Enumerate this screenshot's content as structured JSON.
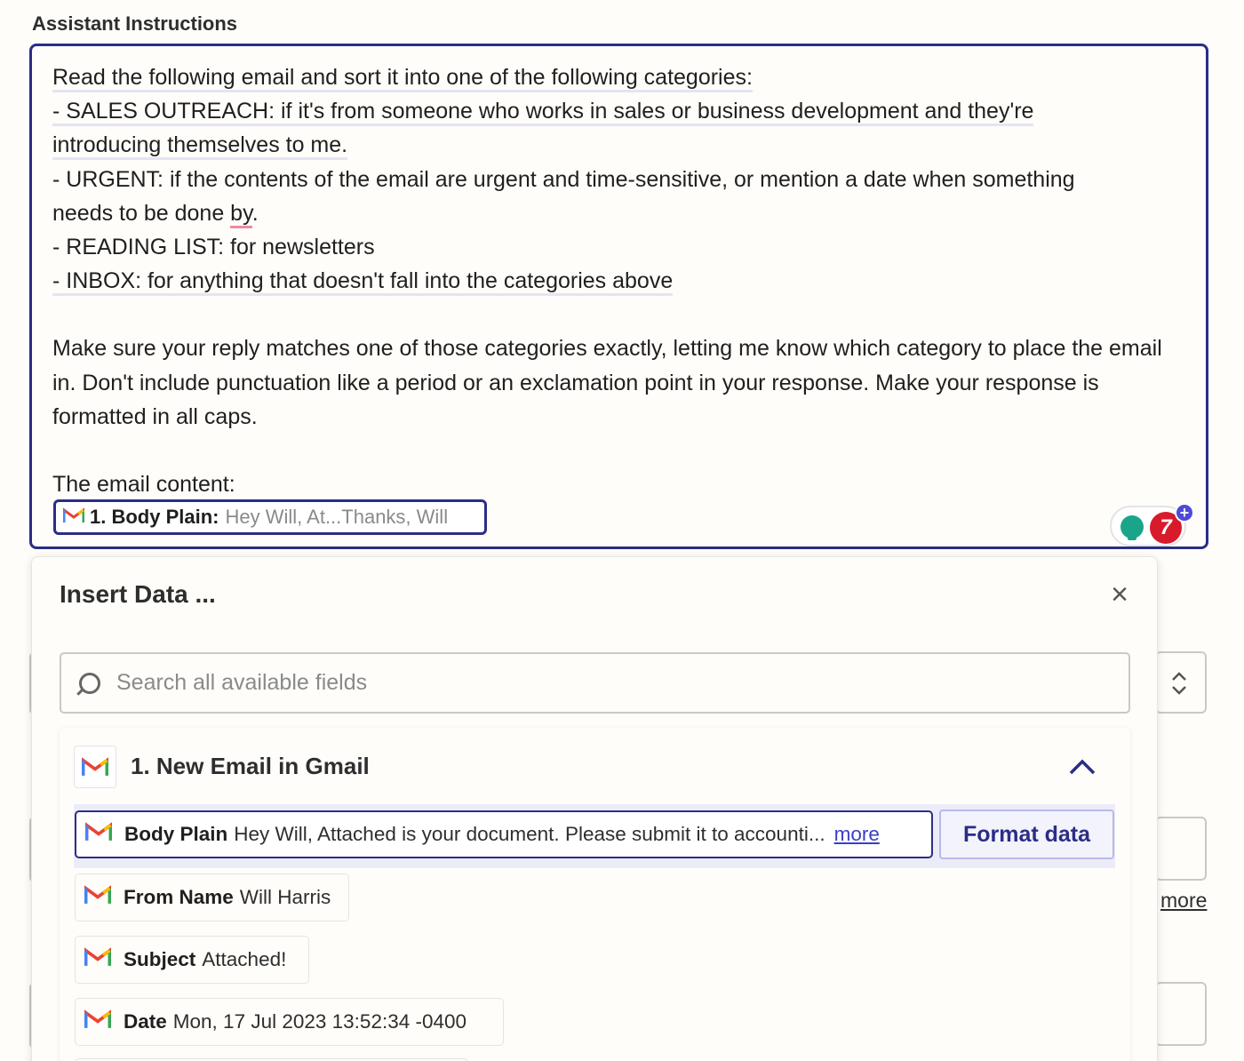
{
  "section_label": "Assistant Instructions",
  "editor": {
    "lines": [
      "Read the following email and sort it into one of the following categories:",
      "- SALES OUTREACH: if it's from someone who works in sales or business development and they're",
      "introducing themselves to me.",
      "- URGENT: if the contents of the email are urgent and time-sensitive, or mention a date when something",
      "needs to be done ",
      "by",
      ".",
      "- READING LIST: for newsletters",
      "- INBOX: for anything that doesn't fall into the categories above",
      "Make sure your reply matches one of those categories exactly, letting me know which category to place the email in. Don't include punctuation like a period or an exclamation point in your response. Make your response is formatted in all caps.",
      "The email content:"
    ],
    "pill": {
      "title": "1. Body Plain:",
      "value": "Hey Will,    At...Thanks,  Will"
    },
    "badge_count": "7",
    "plus": "+"
  },
  "bg_more": "more",
  "insert_panel": {
    "title": "Insert Data ...",
    "close": "×",
    "search_placeholder": "Search all available fields",
    "group_title": "1. New Email in Gmail",
    "items": [
      {
        "key": "Body Plain",
        "value": "Hey Will, Attached is your document. Please submit it to accounti...",
        "more": "more"
      },
      {
        "key": "From Name",
        "value": "Will Harris"
      },
      {
        "key": "Subject",
        "value": "Attached!"
      },
      {
        "key": "Date",
        "value": "Mon, 17 Jul 2023 13:52:34 -0400"
      }
    ],
    "format_button": "Format data"
  },
  "colors": {
    "accent": "#2b2d87",
    "selection": "#ececf9",
    "badge": "#d71b2b",
    "bulb": "#1aa58a"
  },
  "icons": [
    "gmail-icon",
    "search-icon",
    "close-icon",
    "chevron-up-icon",
    "lightbulb-icon",
    "plus-icon",
    "updown-chevron-icon"
  ]
}
